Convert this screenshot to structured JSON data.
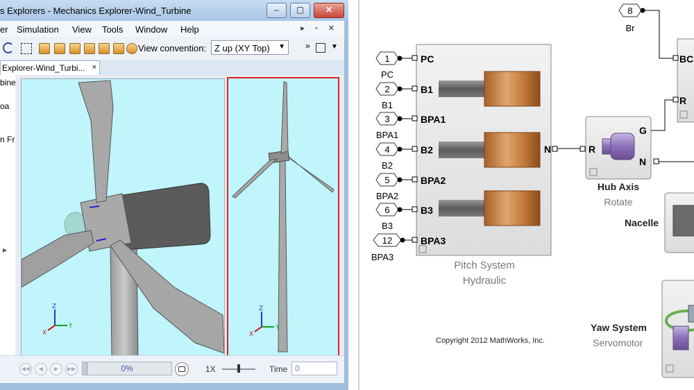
{
  "window": {
    "title": "s Explorers - Mechanics Explorer-Wind_Turbine",
    "controls": {
      "minimize": "‒",
      "maximize": "▢",
      "close": "✕"
    }
  },
  "menu": {
    "items": [
      "er",
      "Simulation",
      "View",
      "Tools",
      "Window",
      "Help"
    ],
    "window_controls": "▸ ▫ ✕"
  },
  "toolbar": {
    "view_convention_label": "View convention:",
    "view_convention_value": "Z up (XY Top)"
  },
  "document_tab": {
    "label": "Explorer-Wind_Turbi...",
    "close": "×"
  },
  "tree": {
    "items": [
      "bine",
      "",
      "oa",
      "",
      "n Fr"
    ]
  },
  "axes_labels": {
    "z": "Z",
    "y": "Y",
    "x": "X"
  },
  "playback": {
    "progress_percent": "0%",
    "progress_value": 0,
    "speed": "1X",
    "time_label": "Time",
    "time_value": "0"
  },
  "diagram": {
    "inports": [
      {
        "num": "1",
        "label": "PC",
        "port": "PC"
      },
      {
        "num": "2",
        "label": "B1",
        "port": "B1"
      },
      {
        "num": "3",
        "label": "BPA1",
        "port": "BPA1"
      },
      {
        "num": "4",
        "label": "B2",
        "port": "B2"
      },
      {
        "num": "5",
        "label": "BPA2",
        "port": "BPA2"
      },
      {
        "num": "6",
        "label": "B3",
        "port": "B3"
      },
      {
        "num": "12",
        "label": "BPA3",
        "port": "BPA3"
      }
    ],
    "brake_inport": {
      "num": "8",
      "label": "Br"
    },
    "pitch_system": {
      "title": "Pitch System",
      "subtitle": "Hydraulic",
      "out_port": "N"
    },
    "hub_axis": {
      "title": "Hub Axis",
      "subtitle": "Rotate",
      "in_port": "R",
      "out_ports": [
        "G",
        "N"
      ]
    },
    "brake_block": {
      "ports": [
        "BC",
        "R"
      ]
    },
    "nacelle": {
      "title": "Nacelle"
    },
    "yaw_system": {
      "title": "Yaw System",
      "subtitle": "Servomotor"
    },
    "copyright": "Copyright 2012 MathWorks, Inc."
  },
  "colors": {
    "viewport_bg": "#bff5fb",
    "selected_view_border": "#e02020",
    "actuator_copper": "#c27a3c",
    "hub_purple": "#8d6fb8"
  }
}
